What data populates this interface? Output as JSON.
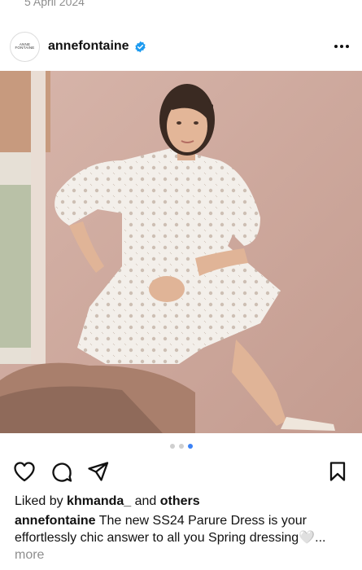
{
  "post": {
    "date": "5 April 2024",
    "account": {
      "name": "annefontaine",
      "avatar_text": "ANNE FONTAINE",
      "verified": true
    },
    "image": {
      "description_icon": "photo-dress-model"
    },
    "carousel": {
      "count": 3,
      "active_index": 2
    },
    "likes": {
      "prefix": "Liked by ",
      "user": "khmanda_",
      "middle": " and ",
      "others": "others"
    },
    "caption": {
      "user": "annefontaine",
      "text": " The new SS24 Parure Dress is your effortlessly chic answer to all you Spring dressing",
      "emoji": "🤍",
      "ellipsis": "...",
      "more": "more"
    }
  },
  "colors": {
    "verified": "#1d9bf0",
    "dot_active": "#3b82f6",
    "dot_inactive": "#cfcfcf",
    "muted": "#8e8e8e"
  },
  "icons": [
    "verified-badge-icon",
    "more-options-icon",
    "heart-icon",
    "comment-icon",
    "share-icon",
    "bookmark-icon"
  ]
}
